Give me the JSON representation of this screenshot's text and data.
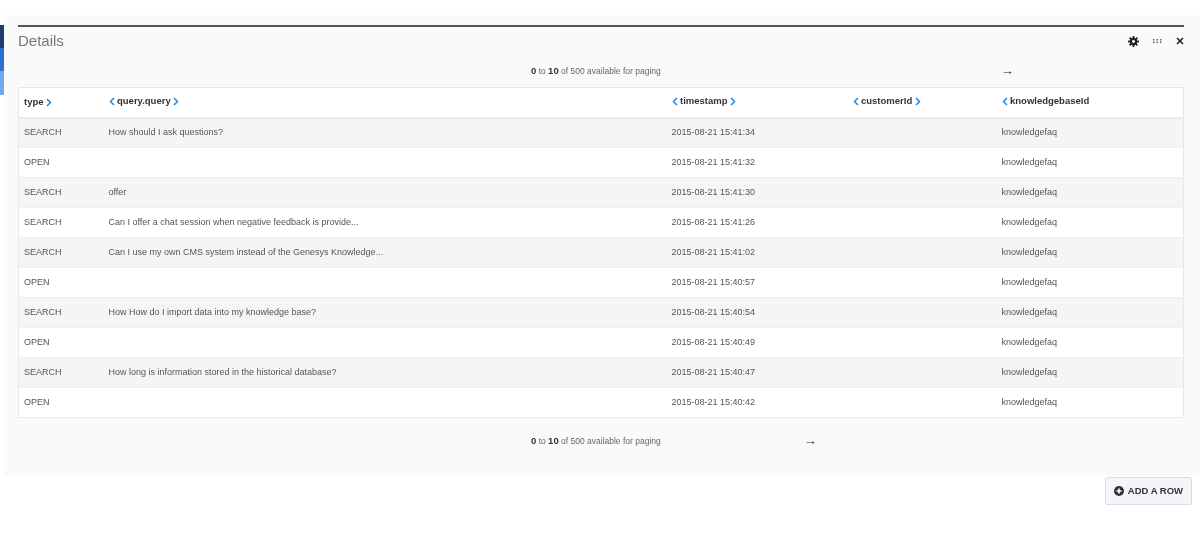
{
  "panel": {
    "title": "Details"
  },
  "pager_top": {
    "text": "**0** to **10** of 500 available for paging",
    "arrow": "→"
  },
  "table": {
    "columns": [
      {
        "label": "type",
        "move_left": false,
        "move_right": true
      },
      {
        "label": "query.query",
        "move_left": true,
        "move_right": true
      },
      {
        "label": "timestamp",
        "move_left": true,
        "move_right": true
      },
      {
        "label": "customerId",
        "move_left": true,
        "move_right": true
      },
      {
        "label": "knowledgebaseId",
        "move_left": true,
        "move_right": false
      }
    ],
    "rows": [
      [
        "SEARCH",
        "How should I ask questions?",
        "2015-08-21 15:41:34",
        "",
        "knowledgefaq"
      ],
      [
        "OPEN",
        "",
        "2015-08-21 15:41:32",
        "",
        "knowledgefaq"
      ],
      [
        "SEARCH",
        "offer",
        "2015-08-21 15:41:30",
        "",
        "knowledgefaq"
      ],
      [
        "SEARCH",
        "Can I offer a chat session when negative feedback is provide...",
        "2015-08-21 15:41:26",
        "",
        "knowledgefaq"
      ],
      [
        "SEARCH",
        "Can I use my own CMS system instead of the Genesys Knowledge...",
        "2015-08-21 15:41:02",
        "",
        "knowledgefaq"
      ],
      [
        "OPEN",
        "",
        "2015-08-21 15:40:57",
        "",
        "knowledgefaq"
      ],
      [
        "SEARCH",
        "How How do I import data into my knowledge base?",
        "2015-08-21 15:40:54",
        "",
        "knowledgefaq"
      ],
      [
        "OPEN",
        "",
        "2015-08-21 15:40:49",
        "",
        "knowledgefaq"
      ],
      [
        "SEARCH",
        "How long is information stored in the historical database?",
        "2015-08-21 15:40:47",
        "",
        "knowledgefaq"
      ],
      [
        "OPEN",
        "",
        "2015-08-21 15:40:42",
        "",
        "knowledgefaq"
      ]
    ]
  },
  "pager_bottom": {
    "text": "**0** to **10** of 500 available for paging",
    "arrow": "→"
  },
  "add_button": {
    "label": "ADD A ROW"
  }
}
